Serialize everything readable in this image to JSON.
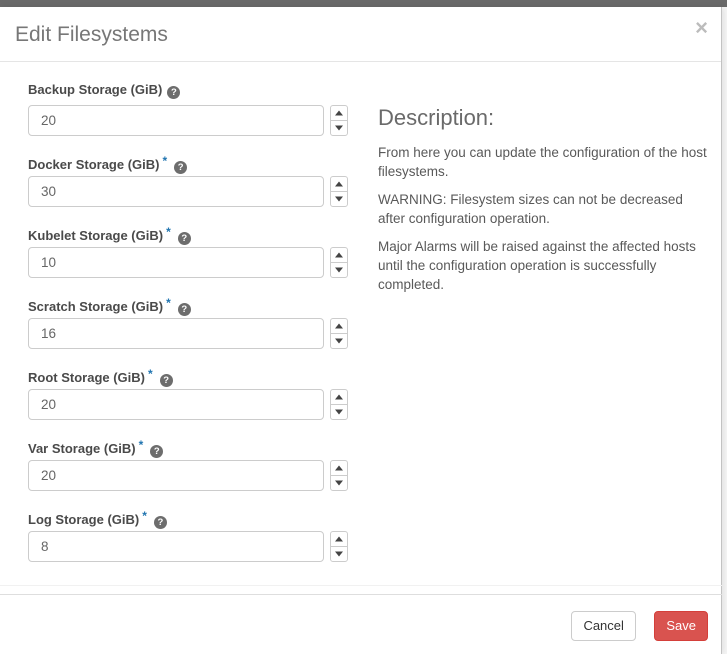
{
  "modal": {
    "title": "Edit Filesystems",
    "close_symbol": "×"
  },
  "form": {
    "required_marker": "*",
    "help_symbol": "?",
    "fields": [
      {
        "label": "Backup Storage (GiB)",
        "value": "20",
        "required": false
      },
      {
        "label": "Docker Storage (GiB)",
        "value": "30",
        "required": true
      },
      {
        "label": "Kubelet Storage (GiB)",
        "value": "10",
        "required": true
      },
      {
        "label": "Scratch Storage (GiB)",
        "value": "16",
        "required": true
      },
      {
        "label": "Root Storage (GiB)",
        "value": "20",
        "required": true
      },
      {
        "label": "Var Storage (GiB)",
        "value": "20",
        "required": true
      },
      {
        "label": "Log Storage (GiB)",
        "value": "8",
        "required": true
      }
    ]
  },
  "description": {
    "title": "Description:",
    "paragraphs": [
      "From here you can update the configuration of the host filesystems.",
      "WARNING: Filesystem sizes can not be decreased after configuration operation.",
      "Major Alarms will be raised against the affected hosts until the configuration operation is successfully completed."
    ]
  },
  "footer": {
    "cancel_label": "Cancel",
    "save_label": "Save"
  },
  "colors": {
    "required_asterisk": "#2175b0",
    "save_button": "#d9534f",
    "help_icon": "#6d6d6d",
    "topbar": "#696969"
  }
}
